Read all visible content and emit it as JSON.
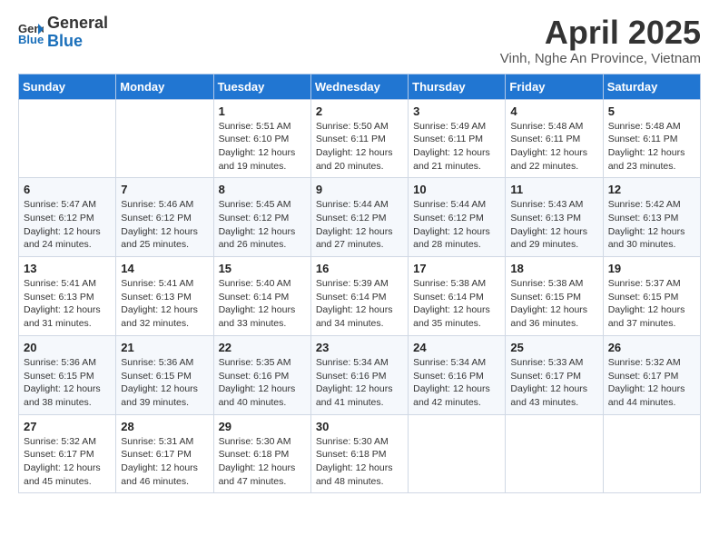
{
  "logo": {
    "general": "General",
    "blue": "Blue"
  },
  "title": "April 2025",
  "subtitle": "Vinh, Nghe An Province, Vietnam",
  "weekdays": [
    "Sunday",
    "Monday",
    "Tuesday",
    "Wednesday",
    "Thursday",
    "Friday",
    "Saturday"
  ],
  "weeks": [
    [
      {
        "day": "",
        "sunrise": "",
        "sunset": "",
        "daylight": ""
      },
      {
        "day": "",
        "sunrise": "",
        "sunset": "",
        "daylight": ""
      },
      {
        "day": "1",
        "sunrise": "Sunrise: 5:51 AM",
        "sunset": "Sunset: 6:10 PM",
        "daylight": "Daylight: 12 hours and 19 minutes."
      },
      {
        "day": "2",
        "sunrise": "Sunrise: 5:50 AM",
        "sunset": "Sunset: 6:11 PM",
        "daylight": "Daylight: 12 hours and 20 minutes."
      },
      {
        "day": "3",
        "sunrise": "Sunrise: 5:49 AM",
        "sunset": "Sunset: 6:11 PM",
        "daylight": "Daylight: 12 hours and 21 minutes."
      },
      {
        "day": "4",
        "sunrise": "Sunrise: 5:48 AM",
        "sunset": "Sunset: 6:11 PM",
        "daylight": "Daylight: 12 hours and 22 minutes."
      },
      {
        "day": "5",
        "sunrise": "Sunrise: 5:48 AM",
        "sunset": "Sunset: 6:11 PM",
        "daylight": "Daylight: 12 hours and 23 minutes."
      }
    ],
    [
      {
        "day": "6",
        "sunrise": "Sunrise: 5:47 AM",
        "sunset": "Sunset: 6:12 PM",
        "daylight": "Daylight: 12 hours and 24 minutes."
      },
      {
        "day": "7",
        "sunrise": "Sunrise: 5:46 AM",
        "sunset": "Sunset: 6:12 PM",
        "daylight": "Daylight: 12 hours and 25 minutes."
      },
      {
        "day": "8",
        "sunrise": "Sunrise: 5:45 AM",
        "sunset": "Sunset: 6:12 PM",
        "daylight": "Daylight: 12 hours and 26 minutes."
      },
      {
        "day": "9",
        "sunrise": "Sunrise: 5:44 AM",
        "sunset": "Sunset: 6:12 PM",
        "daylight": "Daylight: 12 hours and 27 minutes."
      },
      {
        "day": "10",
        "sunrise": "Sunrise: 5:44 AM",
        "sunset": "Sunset: 6:12 PM",
        "daylight": "Daylight: 12 hours and 28 minutes."
      },
      {
        "day": "11",
        "sunrise": "Sunrise: 5:43 AM",
        "sunset": "Sunset: 6:13 PM",
        "daylight": "Daylight: 12 hours and 29 minutes."
      },
      {
        "day": "12",
        "sunrise": "Sunrise: 5:42 AM",
        "sunset": "Sunset: 6:13 PM",
        "daylight": "Daylight: 12 hours and 30 minutes."
      }
    ],
    [
      {
        "day": "13",
        "sunrise": "Sunrise: 5:41 AM",
        "sunset": "Sunset: 6:13 PM",
        "daylight": "Daylight: 12 hours and 31 minutes."
      },
      {
        "day": "14",
        "sunrise": "Sunrise: 5:41 AM",
        "sunset": "Sunset: 6:13 PM",
        "daylight": "Daylight: 12 hours and 32 minutes."
      },
      {
        "day": "15",
        "sunrise": "Sunrise: 5:40 AM",
        "sunset": "Sunset: 6:14 PM",
        "daylight": "Daylight: 12 hours and 33 minutes."
      },
      {
        "day": "16",
        "sunrise": "Sunrise: 5:39 AM",
        "sunset": "Sunset: 6:14 PM",
        "daylight": "Daylight: 12 hours and 34 minutes."
      },
      {
        "day": "17",
        "sunrise": "Sunrise: 5:38 AM",
        "sunset": "Sunset: 6:14 PM",
        "daylight": "Daylight: 12 hours and 35 minutes."
      },
      {
        "day": "18",
        "sunrise": "Sunrise: 5:38 AM",
        "sunset": "Sunset: 6:15 PM",
        "daylight": "Daylight: 12 hours and 36 minutes."
      },
      {
        "day": "19",
        "sunrise": "Sunrise: 5:37 AM",
        "sunset": "Sunset: 6:15 PM",
        "daylight": "Daylight: 12 hours and 37 minutes."
      }
    ],
    [
      {
        "day": "20",
        "sunrise": "Sunrise: 5:36 AM",
        "sunset": "Sunset: 6:15 PM",
        "daylight": "Daylight: 12 hours and 38 minutes."
      },
      {
        "day": "21",
        "sunrise": "Sunrise: 5:36 AM",
        "sunset": "Sunset: 6:15 PM",
        "daylight": "Daylight: 12 hours and 39 minutes."
      },
      {
        "day": "22",
        "sunrise": "Sunrise: 5:35 AM",
        "sunset": "Sunset: 6:16 PM",
        "daylight": "Daylight: 12 hours and 40 minutes."
      },
      {
        "day": "23",
        "sunrise": "Sunrise: 5:34 AM",
        "sunset": "Sunset: 6:16 PM",
        "daylight": "Daylight: 12 hours and 41 minutes."
      },
      {
        "day": "24",
        "sunrise": "Sunrise: 5:34 AM",
        "sunset": "Sunset: 6:16 PM",
        "daylight": "Daylight: 12 hours and 42 minutes."
      },
      {
        "day": "25",
        "sunrise": "Sunrise: 5:33 AM",
        "sunset": "Sunset: 6:17 PM",
        "daylight": "Daylight: 12 hours and 43 minutes."
      },
      {
        "day": "26",
        "sunrise": "Sunrise: 5:32 AM",
        "sunset": "Sunset: 6:17 PM",
        "daylight": "Daylight: 12 hours and 44 minutes."
      }
    ],
    [
      {
        "day": "27",
        "sunrise": "Sunrise: 5:32 AM",
        "sunset": "Sunset: 6:17 PM",
        "daylight": "Daylight: 12 hours and 45 minutes."
      },
      {
        "day": "28",
        "sunrise": "Sunrise: 5:31 AM",
        "sunset": "Sunset: 6:17 PM",
        "daylight": "Daylight: 12 hours and 46 minutes."
      },
      {
        "day": "29",
        "sunrise": "Sunrise: 5:30 AM",
        "sunset": "Sunset: 6:18 PM",
        "daylight": "Daylight: 12 hours and 47 minutes."
      },
      {
        "day": "30",
        "sunrise": "Sunrise: 5:30 AM",
        "sunset": "Sunset: 6:18 PM",
        "daylight": "Daylight: 12 hours and 48 minutes."
      },
      {
        "day": "",
        "sunrise": "",
        "sunset": "",
        "daylight": ""
      },
      {
        "day": "",
        "sunrise": "",
        "sunset": "",
        "daylight": ""
      },
      {
        "day": "",
        "sunrise": "",
        "sunset": "",
        "daylight": ""
      }
    ]
  ]
}
